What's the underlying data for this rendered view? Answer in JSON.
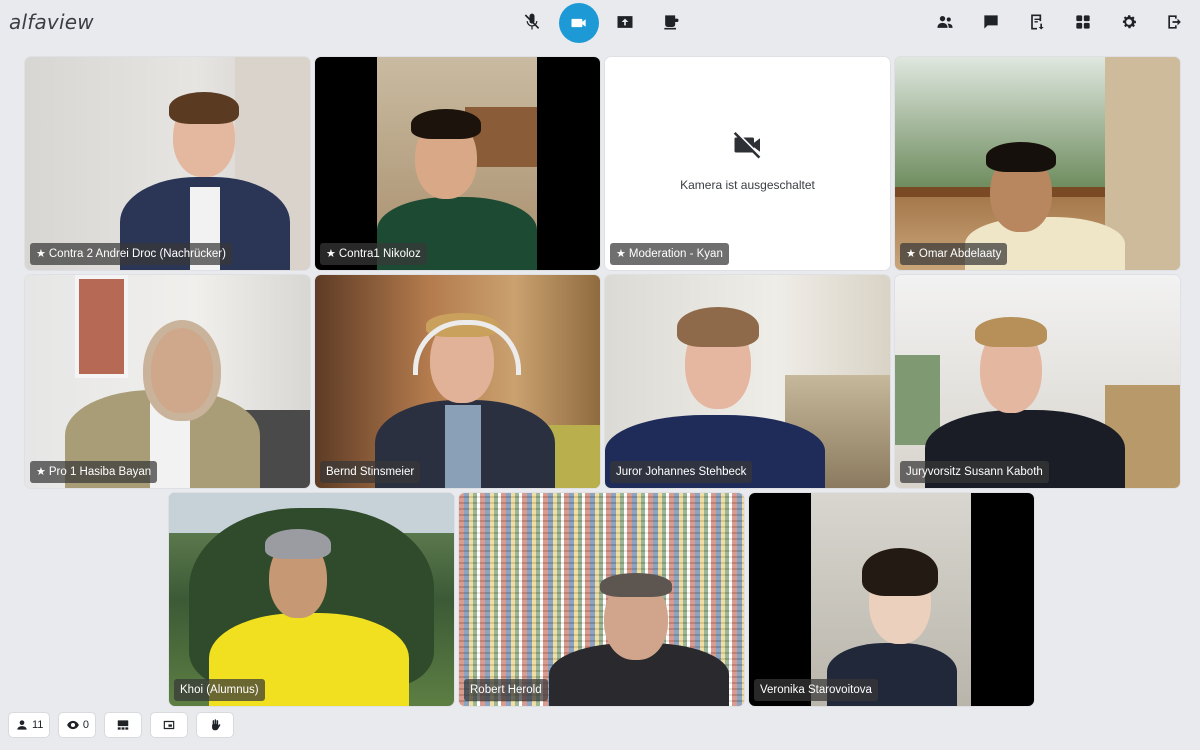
{
  "app": {
    "logo": "alfaview"
  },
  "toolbar_center": [
    {
      "icon": "mic-off-icon",
      "active": false
    },
    {
      "icon": "video-camera-icon",
      "active": true
    },
    {
      "icon": "screen-share-icon",
      "active": false
    },
    {
      "icon": "coffee-break-icon",
      "active": false
    }
  ],
  "toolbar_right": [
    "participants-icon",
    "chat-icon",
    "notes-icon",
    "layout-grid-icon",
    "settings-icon",
    "leave-icon"
  ],
  "tiles": [
    {
      "label": "Contra 2 Andrei Droc (Nachrücker)",
      "starred": true
    },
    {
      "label": "Contra1 Nikoloz",
      "starred": true
    },
    {
      "label": "Moderation - Kyan",
      "starred": true,
      "camera_off": true,
      "camera_off_text": "Kamera ist ausgeschaltet"
    },
    {
      "label": "Omar Abdelaaty",
      "starred": true
    },
    {
      "label": "Pro 1   Hasiba Bayan",
      "starred": true
    },
    {
      "label": "Bernd Stinsmeier",
      "starred": false
    },
    {
      "label": "Juror Johannes Stehbeck",
      "starred": false
    },
    {
      "label": "Juryvorsitz Susann Kaboth",
      "starred": false
    },
    {
      "label": "Khoi (Alumnus)",
      "starred": false
    },
    {
      "label": "Robert Herold",
      "starred": false
    },
    {
      "label": "Veronika Starovoitova",
      "starred": false
    }
  ],
  "bottom_bar": {
    "participants_count": "11",
    "viewers_count": "0"
  },
  "colors": {
    "accent": "#1d9ad6",
    "background": "#e8eaed"
  }
}
